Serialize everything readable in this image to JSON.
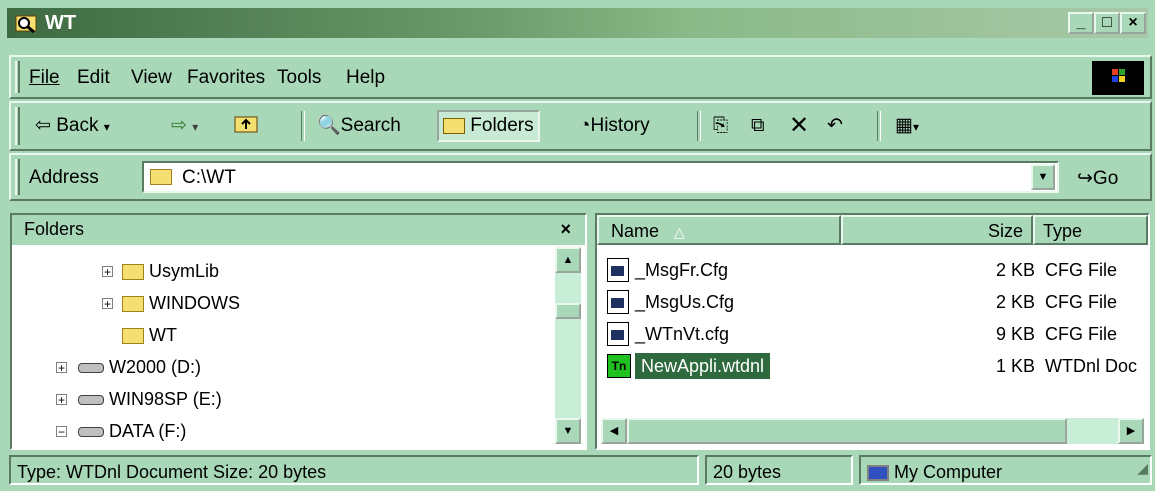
{
  "window": {
    "title": "WT"
  },
  "menu": {
    "file": "File",
    "edit": "Edit",
    "view": "View",
    "favorites": "Favorites",
    "tools": "Tools",
    "help": "Help"
  },
  "toolbar": {
    "back": "Back",
    "search": "Search",
    "folders": "Folders",
    "history": "History"
  },
  "address": {
    "label": "Address",
    "value": "C:\\WT",
    "go": "Go"
  },
  "folders_pane": {
    "title": "Folders",
    "close": "×",
    "items": [
      "UsymLib",
      "WINDOWS",
      "WT",
      "W2000 (D:)",
      "WIN98SP (E:)",
      "DATA (F:)"
    ]
  },
  "file_list": {
    "columns": [
      "Name",
      "Size",
      "Type"
    ],
    "rows": [
      {
        "name": "_MsgFr.Cfg",
        "size": "2 KB",
        "type": "CFG File"
      },
      {
        "name": "_MsgUs.Cfg",
        "size": "2 KB",
        "type": "CFG File"
      },
      {
        "name": "_WTnVt.cfg",
        "size": "9 KB",
        "type": "CFG File"
      },
      {
        "name": "NewAppli.wtdnl",
        "size": "1 KB",
        "type": "WTDnl Doc"
      }
    ]
  },
  "status": {
    "text": "Type: WTDnl Document Size: 20 bytes",
    "size": "20 bytes",
    "zone": "My Computer"
  },
  "colors": {
    "face": "#a8d8b8",
    "selection": "#2e6a3e",
    "title_start": "#3e6a42"
  }
}
